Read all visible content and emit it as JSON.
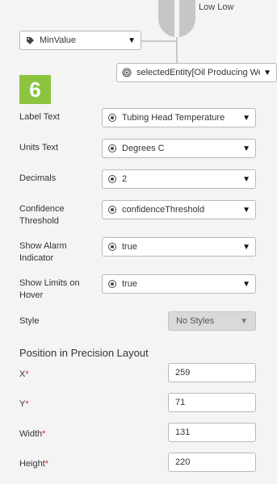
{
  "gauge": {
    "label": "Low Low"
  },
  "min_value_dropdown": {
    "value": "MinValue",
    "icon": "tag-icon"
  },
  "entity_dropdown": {
    "value": "selectedEntity[Oil Producing We",
    "icon": "target-icon"
  },
  "step": {
    "number": "6",
    "color": "#8cc43f"
  },
  "rows": [
    {
      "label_line1": "Label Text",
      "label_line2": "",
      "value": "Tubing Head Temperature"
    },
    {
      "label_line1": "Units Text",
      "label_line2": "",
      "value": "Degrees C"
    },
    {
      "label_line1": "Decimals",
      "label_line2": "",
      "value": "2"
    },
    {
      "label_line1": "Confidence",
      "label_line2": "Threshold",
      "value": "confidenceThreshold"
    },
    {
      "label_line1": "Show Alarm",
      "label_line2": "Indicator",
      "value": "true"
    },
    {
      "label_line1": "Show Limits on",
      "label_line2": "Hover",
      "value": "true"
    }
  ],
  "style": {
    "label": "Style",
    "value": "No Styles"
  },
  "position": {
    "title": "Position in Precision Layout",
    "x": {
      "label": "X",
      "value": "259"
    },
    "y": {
      "label": "Y",
      "value": "71"
    },
    "width": {
      "label": "Width",
      "value": "131"
    },
    "height": {
      "label": "Height",
      "value": "220"
    },
    "required_marker": "*"
  },
  "dropdown_caret": "▼"
}
